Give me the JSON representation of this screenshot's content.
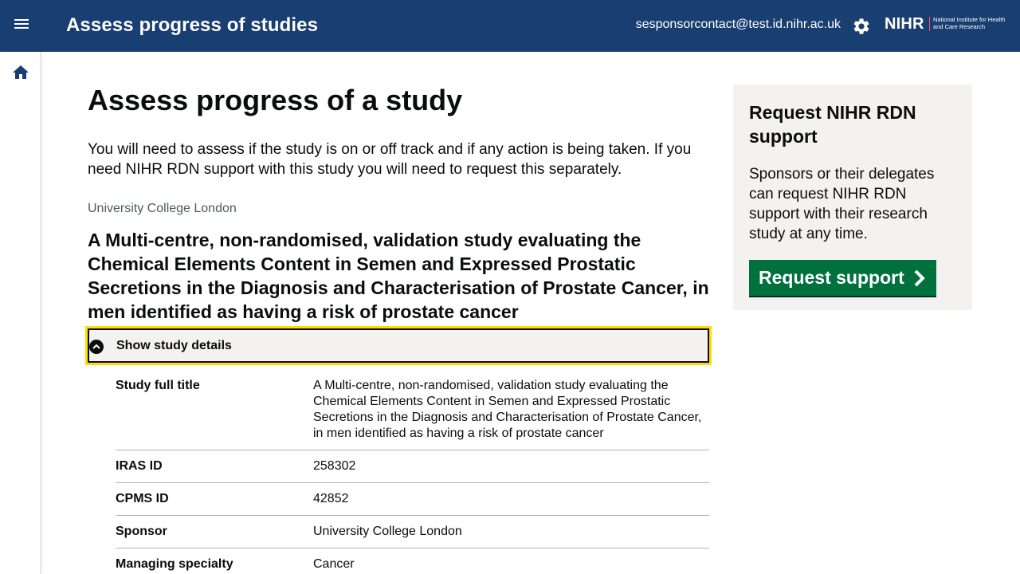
{
  "header": {
    "app_title": "Assess progress of studies",
    "user_email": "sesponsorcontact@test.id.nihr.ac.uk",
    "logo_text": "NIHR",
    "logo_subtext": "National Institute for Health and Care Research"
  },
  "sidebar": {
    "home_icon": "home-icon"
  },
  "main": {
    "page_title": "Assess progress of a study",
    "intro": "You will need to assess if the study is on or off track and if any action is being taken. If you need NIHR RDN support with this study you will need to request this separately.",
    "caption": "University College London",
    "study_title": "A Multi-centre, non-randomised, validation study evaluating the Chemical Elements Content in Semen and Expressed Prostatic Secretions in the Diagnosis and Characterisation of Prostate Cancer, in men identified as having a risk of prostate cancer",
    "details_toggle_label": "Show study details",
    "summary": [
      {
        "key": "Study full title",
        "value": "A Multi-centre, non-randomised, validation study evaluating the Chemical Elements Content in Semen and Expressed Prostatic Secretions in the Diagnosis and Characterisation of Prostate Cancer, in men identified as having a risk of prostate cancer"
      },
      {
        "key": "IRAS ID",
        "value": "258302"
      },
      {
        "key": "CPMS ID",
        "value": "42852"
      },
      {
        "key": "Sponsor",
        "value": "University College London"
      },
      {
        "key": "Managing specialty",
        "value": "Cancer"
      }
    ]
  },
  "aside": {
    "title": "Request NIHR RDN support",
    "text": "Sponsors or their delegates can request NIHR RDN support with their research study at any time.",
    "button_label": "Request support"
  },
  "colors": {
    "header_bg": "#193e72",
    "button_green": "#00703c",
    "focus_yellow": "#ffdd00",
    "panel_grey": "#f3f2f1"
  }
}
